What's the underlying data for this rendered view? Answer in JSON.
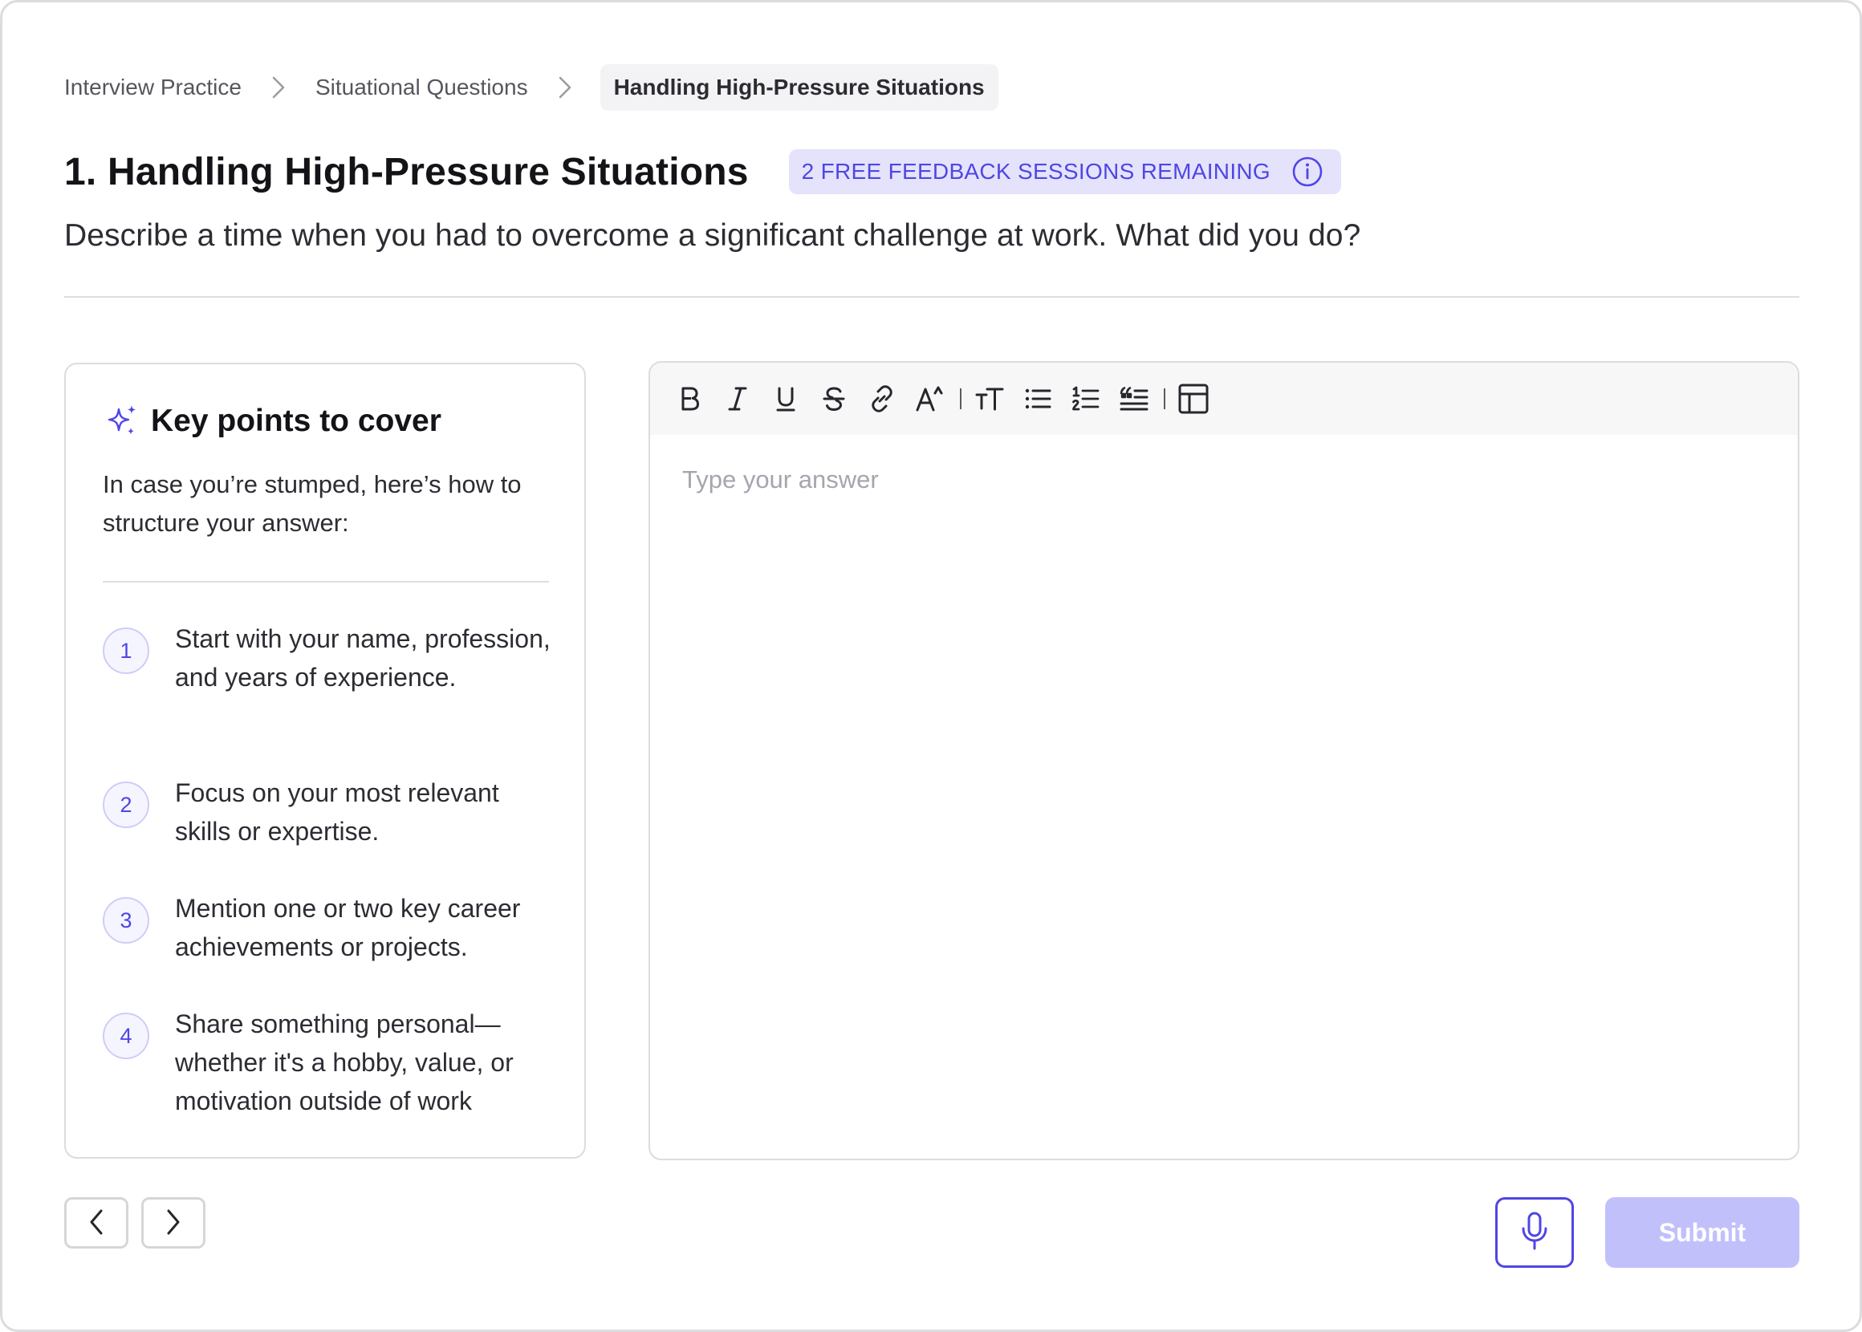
{
  "breadcrumb": {
    "items": [
      "Interview Practice",
      "Situational Questions"
    ],
    "current": "Handling High-Pressure Situations"
  },
  "header": {
    "title": "1. Handling High-Pressure Situations",
    "badge": "2 FREE FEEDBACK SESSIONS REMAINING",
    "question": "Describe a time when you had to overcome a significant challenge at work. What did you do?"
  },
  "key_points": {
    "title": "Key points to cover",
    "intro": "In case you’re stumped, here’s how to structure your answer:",
    "items": [
      {
        "number": "1",
        "text": "Start with your name, profession, and years of experience."
      },
      {
        "number": "2",
        "text": "Focus on your most relevant skills or expertise."
      },
      {
        "number": "3",
        "text": "Mention one or two key career achievements or projects."
      },
      {
        "number": "4",
        "text": "Share something personal—whether it's a hobby, value, or motivation outside of work"
      }
    ]
  },
  "editor": {
    "placeholder": "Type your answer",
    "value": "",
    "toolbar": [
      "bold-icon",
      "italic-icon",
      "underline-icon",
      "strikethrough-icon",
      "link-icon",
      "font-size-icon",
      "text-style-icon",
      "bullet-list-icon",
      "numbered-list-icon",
      "quote-icon",
      "table-icon"
    ]
  },
  "actions": {
    "submit_label": "Submit"
  },
  "colors": {
    "accent": "#4f46e5",
    "badge_bg": "#e4e3fb",
    "submit_disabled": "#c2c0fb",
    "border": "#dcdce0"
  }
}
